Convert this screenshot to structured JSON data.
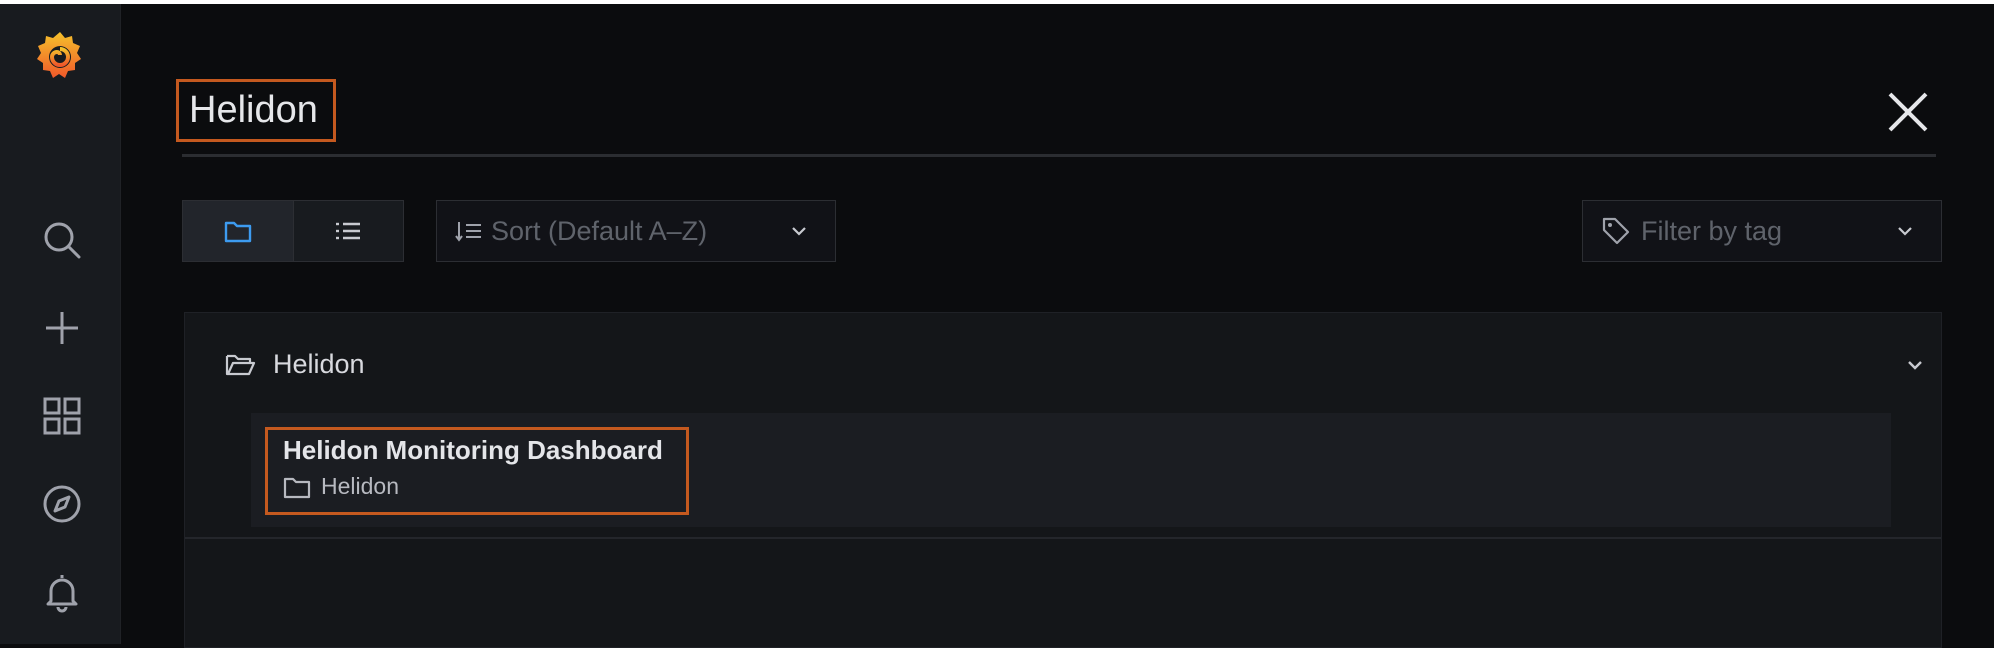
{
  "search": {
    "query": "Helidon"
  },
  "toolbar": {
    "sort_placeholder": "Sort (Default A–Z)",
    "tag_placeholder": "Filter by tag"
  },
  "results": {
    "folder_name": "Helidon",
    "items": [
      {
        "title": "Helidon Monitoring Dashboard",
        "folder": "Helidon"
      }
    ]
  },
  "sidebar": {
    "icons": [
      "grafana-logo-icon",
      "search-icon",
      "plus-icon",
      "dashboards-icon",
      "explore-icon",
      "bell-icon"
    ]
  },
  "colors": {
    "highlight": "#c4591f",
    "accent": "#3d71d9"
  }
}
